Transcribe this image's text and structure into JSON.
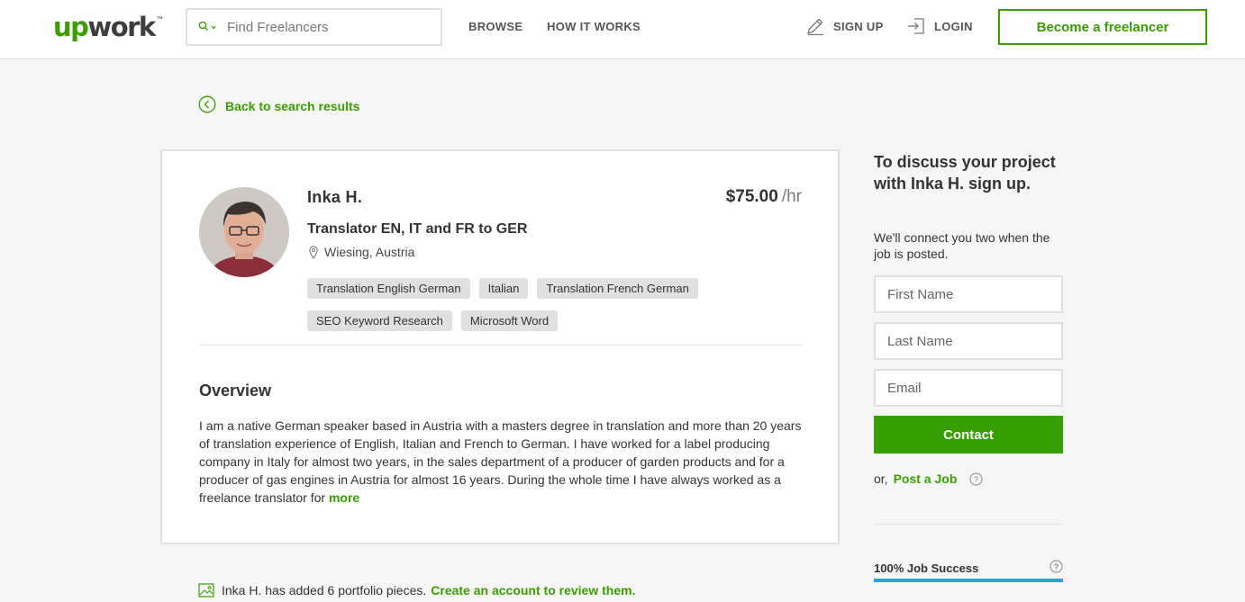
{
  "header": {
    "logo_text_up": "up",
    "logo_text_work": "work",
    "logo_tm": "™",
    "search_placeholder": "Find Freelancers",
    "nav_browse": "BROWSE",
    "nav_how": "HOW IT WORKS",
    "nav_signup": "SIGN UP",
    "nav_login": "LOGIN",
    "become_label": "Become a freelancer"
  },
  "back_link": "Back to search results",
  "profile": {
    "name": "Inka H.",
    "rate_amount": "$75.00",
    "rate_unit": "/hr",
    "title": "Translator EN, IT and FR to GER",
    "location": "Wiesing, Austria",
    "skills": [
      "Translation English German",
      "Italian",
      "Translation French German",
      "SEO Keyword Research",
      "Microsoft Word"
    ],
    "overview_title": "Overview",
    "overview_text": "I am a native German speaker based in Austria with a masters degree in translation and more than 20 years of translation experience of English, Italian and French to German. I have worked for a label producing company in Italy for almost two years, in the sales department of a producer of garden products and for a producer of gas engines in Austria for almost 16 years. During the whole time I have always worked as a freelance translator for",
    "overview_more": "more"
  },
  "sidebar": {
    "title": "To discuss your project with Inka H. sign up.",
    "subtitle": "We'll connect you two when the job is posted.",
    "first_name_placeholder": "First Name",
    "last_name_placeholder": "Last Name",
    "email_placeholder": "Email",
    "contact_label": "Contact",
    "or_label": "or,",
    "post_job_label": "Post a Job",
    "job_success_label": "100% Job Success",
    "job_success_value": 1.0
  },
  "portfolio": {
    "text": "Inka H. has added 6 portfolio pieces.",
    "cta": "Create an account to review them."
  },
  "colors": {
    "brand_green": "#37a000",
    "job_success_blue": "#1caadb"
  }
}
